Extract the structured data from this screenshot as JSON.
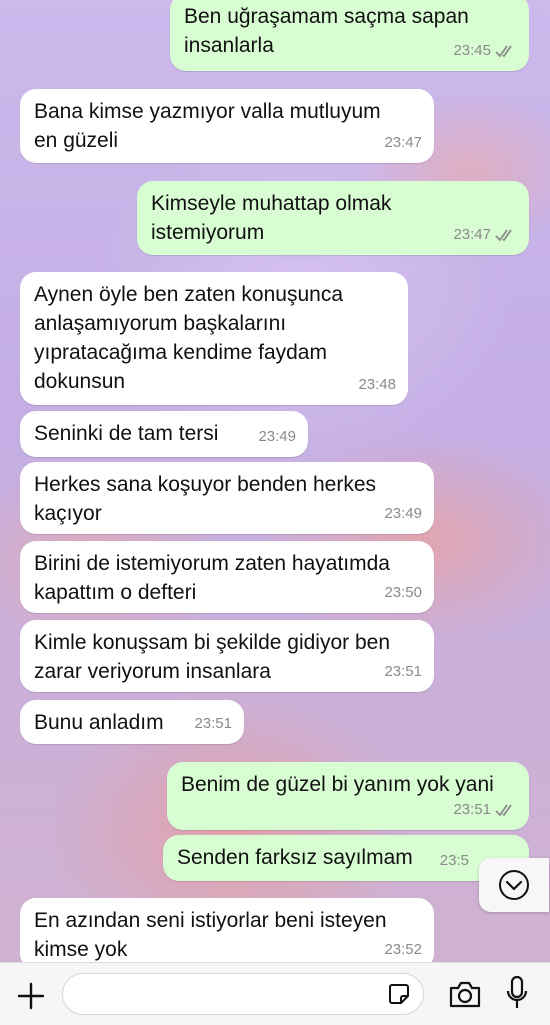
{
  "messages": [
    {
      "direction": "out",
      "text": "Ben uğraşamam saçma sapan\ninsanlarla",
      "time": "23:45",
      "read": true
    },
    {
      "direction": "in",
      "text": "Bana kimse yazmıyor valla mutluyum\nen güzeli",
      "time": "23:47"
    },
    {
      "direction": "out",
      "text": "Kimseyle muhattap olmak\nistemiyorum",
      "time": "23:47",
      "read": true
    },
    {
      "direction": "in",
      "text": "Aynen öyle ben zaten konuşunca\nanlaşamıyorum başkalarını\nyıpratacağıma kendime faydam\ndokunsun",
      "time": "23:48"
    },
    {
      "direction": "in",
      "text": "Seninki de tam tersi",
      "time": "23:49"
    },
    {
      "direction": "in",
      "text": "Herkes sana koşuyor benden herkes\nkaçıyor",
      "time": "23:49"
    },
    {
      "direction": "in",
      "text": "Birini de istemiyorum zaten hayatımda\nkapattım o defteri",
      "time": "23:50"
    },
    {
      "direction": "in",
      "text": "Kimle konuşsam bi şekilde gidiyor ben\nzarar veriyorum insanlara",
      "time": "23:51"
    },
    {
      "direction": "in",
      "text": "Bunu anladım",
      "time": "23:51"
    },
    {
      "direction": "out",
      "text": "Benim de güzel bi yanım yok yani",
      "time": "23:51",
      "read": true
    },
    {
      "direction": "out",
      "text": "Senden farksız sayılmam",
      "time": "23:5"
    },
    {
      "direction": "in",
      "text": "En azından seni istiyorlar beni isteyen\nkimse yok",
      "time": "23:52"
    }
  ],
  "icons": {
    "scroll_down": "chevron-down-icon",
    "attach": "plus-icon",
    "sticker": "sticker-icon",
    "camera": "camera-icon",
    "mic": "microphone-icon"
  },
  "colors": {
    "incoming_bubble": "#ffffff",
    "outgoing_bubble": "#d9fdd3",
    "read_ticks": "#8a8a8a"
  }
}
